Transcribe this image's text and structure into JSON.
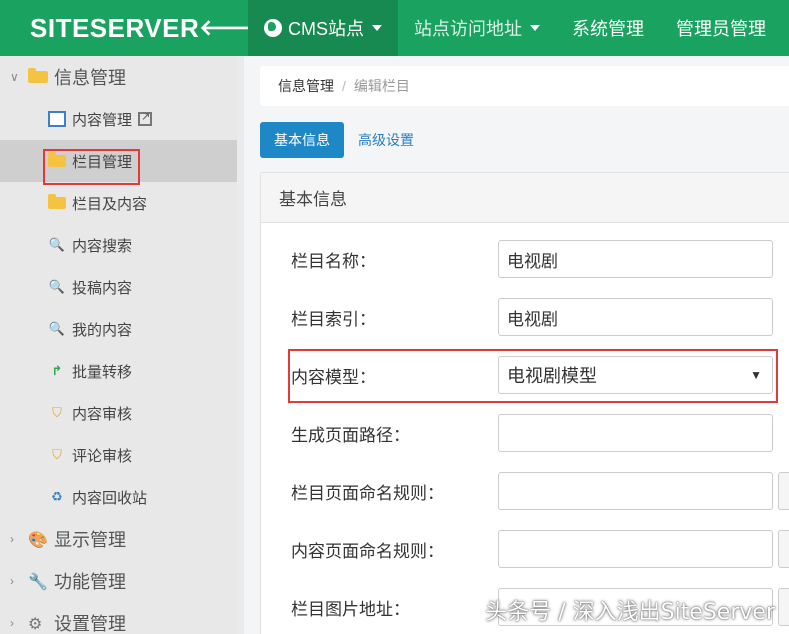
{
  "brand": {
    "name": "SITESERVER",
    "back_icon": "arrow-left-icon"
  },
  "nav": {
    "cms": "CMS站点",
    "site_url": "站点访问地址",
    "system": "系统管理",
    "admin": "管理员管理"
  },
  "sidebar": {
    "group_info": "信息管理",
    "items": [
      {
        "label": "内容管理",
        "icon": "window-icon"
      },
      {
        "label": "栏目管理",
        "icon": "folder-icon"
      },
      {
        "label": "栏目及内容",
        "icon": "folder-icon"
      },
      {
        "label": "内容搜索",
        "icon": "search-icon"
      },
      {
        "label": "投稿内容",
        "icon": "search-icon"
      },
      {
        "label": "我的内容",
        "icon": "search-icon"
      },
      {
        "label": "批量转移",
        "icon": "arrow-icon"
      },
      {
        "label": "内容审核",
        "icon": "shield-icon"
      },
      {
        "label": "评论审核",
        "icon": "shield-icon"
      },
      {
        "label": "内容回收站",
        "icon": "recycle-icon"
      }
    ],
    "group_display": "显示管理",
    "group_function": "功能管理",
    "group_settings": "设置管理"
  },
  "breadcrumb": {
    "root": "信息管理",
    "sep": "/",
    "current": "编辑栏目"
  },
  "tabs": {
    "basic": "基本信息",
    "advanced": "高级设置"
  },
  "panel": {
    "title": "基本信息"
  },
  "form": {
    "name_label": "栏目名称：",
    "name_value": "电视剧",
    "index_label": "栏目索引：",
    "index_value": "电视剧",
    "model_label": "内容模型：",
    "model_value": "电视剧模型",
    "path_label": "生成页面路径：",
    "path_value": "",
    "channel_rule_label": "栏目页面命名规则：",
    "channel_rule_value": "",
    "content_rule_label": "内容页面命名规则：",
    "content_rule_value": "",
    "image_label": "栏目图片地址：",
    "image_value": ""
  },
  "watermark": "头条号 / 深入浅出SiteServer",
  "colors": {
    "topbar": "#1aa260",
    "highlight": "#e03b3b",
    "tab_active": "#1e88c7"
  }
}
